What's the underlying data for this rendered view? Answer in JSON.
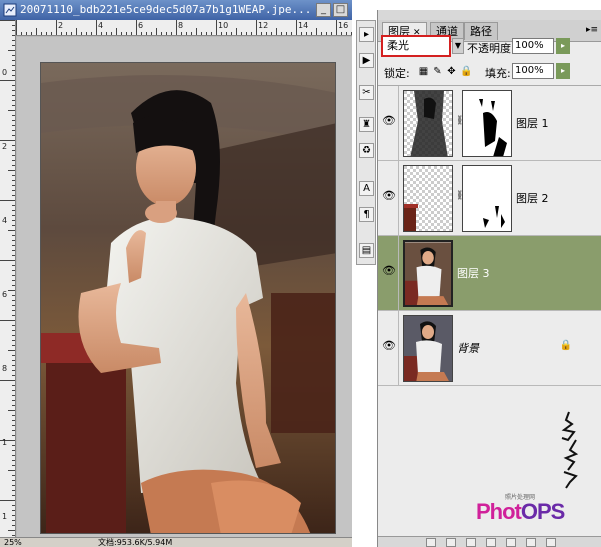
{
  "document": {
    "title": "20071110_bdb221e5ce9dec5d07a7b1g1WEAP.jpe...",
    "zoom": "25%",
    "doc_info": "文档:953.6K/5.94M",
    "ruler_top_numbers": [
      "2",
      "4",
      "6",
      "8",
      "10",
      "12",
      "14",
      "16"
    ],
    "ruler_left_numbers": [
      "0",
      "2",
      "4",
      "6",
      "8",
      "1",
      "1"
    ]
  },
  "tools": [
    "move-tool",
    "play-tool",
    "scissors-tool",
    "stamp-tool",
    "history-brush-tool",
    "type-tool",
    "paragraph-tool",
    "layout-tool"
  ],
  "layers_panel": {
    "tabs": [
      {
        "label": "图层",
        "active": true
      },
      {
        "label": "通道",
        "active": false
      },
      {
        "label": "路径",
        "active": false
      }
    ],
    "blend_mode": "柔光",
    "opacity_label": "不透明度:",
    "opacity_value": "100%",
    "lock_label": "锁定:",
    "fill_label": "填充:",
    "fill_value": "100%",
    "layers": [
      {
        "name": "图层 1",
        "has_mask": true,
        "selected": false,
        "locked": false
      },
      {
        "name": "图层 2",
        "has_mask": true,
        "selected": false,
        "locked": false
      },
      {
        "name": "图层 3",
        "has_mask": false,
        "selected": true,
        "locked": false
      },
      {
        "name": "背景",
        "has_mask": false,
        "selected": false,
        "locked": true
      }
    ]
  },
  "watermark": {
    "small_text": "照片处理网",
    "logo_photo": "Phot",
    "logo_ps": "OPS"
  },
  "colors": {
    "title_bar": "#4f74b8",
    "selected_layer": "#8a9d6c",
    "blend_highlight": "#d42020",
    "logo_pink": "#d0219a",
    "logo_purple": "#6a2aa8"
  }
}
